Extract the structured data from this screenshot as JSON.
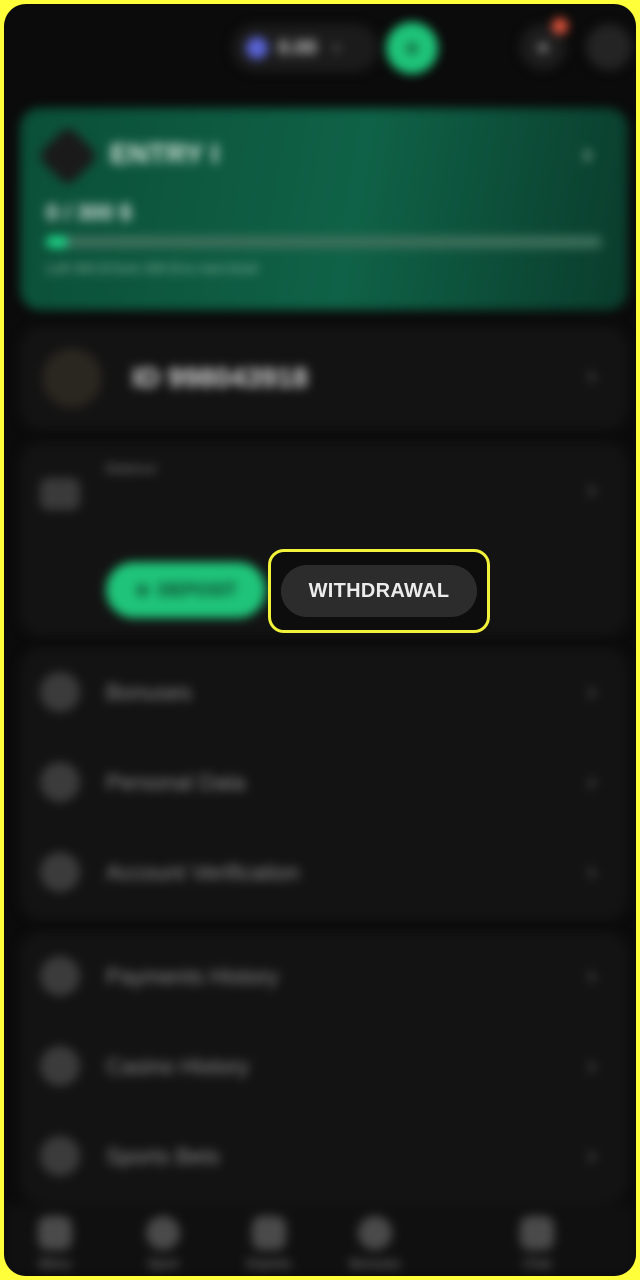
{
  "header": {
    "balance": "0.00",
    "deposit_symbol": "+"
  },
  "level": {
    "title": "ENTRY I",
    "progress_text": "0 / 300 $",
    "progress": 0.04,
    "note": "Left 300 $ from 300 $ to next level"
  },
  "account": {
    "id_text": "ID 998043918"
  },
  "balance": {
    "label": "Balance",
    "deposit_label": "DEPOSIT",
    "withdrawal_label": "WITHDRAWAL"
  },
  "menu_group_1": [
    {
      "label": "Bonuses",
      "icon": "gift-icon"
    },
    {
      "label": "Personal Data",
      "icon": "user-icon"
    },
    {
      "label": "Account Verification",
      "icon": "shield-icon"
    }
  ],
  "menu_group_2": [
    {
      "label": "Payments History",
      "icon": "history-icon"
    },
    {
      "label": "Casino History",
      "icon": "casino-icon"
    },
    {
      "label": "Sports Bets",
      "icon": "ticket-icon"
    }
  ],
  "bottom_nav": [
    {
      "label": "Menu",
      "icon": "menu-icon"
    },
    {
      "label": "Sport",
      "icon": "ball-icon"
    },
    {
      "label": "Esports",
      "icon": "gamepad-icon"
    },
    {
      "label": "Bonuses",
      "icon": "gift-icon"
    },
    {
      "label": "Chat",
      "icon": "chat-icon"
    }
  ],
  "colors": {
    "accent": "#1fc47a",
    "highlight": "#f2f23a",
    "background": "#0b0b0b"
  }
}
